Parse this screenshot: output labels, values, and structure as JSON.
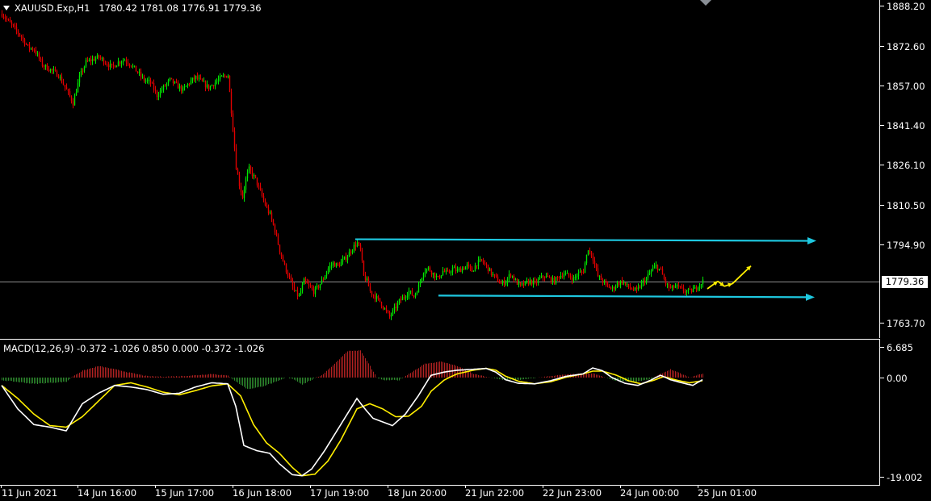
{
  "header": {
    "symbol": "XAUUSD.Exp,H1",
    "ohlc": "1780.42 1781.08 1776.91 1779.36"
  },
  "macd": {
    "label": "MACD(12,26,9) -0.372 -1.026 0.850 0.000 -0.372 -1.026",
    "scale": [
      "6.685",
      "0.00",
      "-19.002"
    ]
  },
  "price_axis": [
    "1888.20",
    "1872.60",
    "1857.00",
    "1841.40",
    "1826.10",
    "1810.50",
    "1794.90",
    "1779.36",
    "1763.70"
  ],
  "current_price": "1779.36",
  "time_axis": [
    "11 Jun 2021",
    "14 Jun 16:00",
    "15 Jun 17:00",
    "16 Jun 18:00",
    "17 Jun 19:00",
    "18 Jun 20:00",
    "21 Jun 22:00",
    "22 Jun 23:00",
    "24 Jun 00:00",
    "25 Jun 01:00"
  ],
  "colors": {
    "background": "#000000",
    "bull": "#00e600",
    "bear": "#e00000",
    "channel": "#1ec8e0",
    "projection": "#ffee00",
    "macd_line": "#ffffff",
    "signal_line": "#ffee00",
    "hist_pos": "#b22222",
    "hist_neg": "#2e8b2e"
  },
  "chart_data": {
    "type": "candlestick",
    "symbol": "XAUUSD.Exp",
    "timeframe": "H1",
    "price_ylim": [
      1760.0,
      1890.5
    ],
    "close_path": [
      [
        0,
        1885
      ],
      [
        4,
        1882
      ],
      [
        8,
        1879
      ],
      [
        12,
        1876
      ],
      [
        16,
        1872
      ],
      [
        20,
        1871
      ],
      [
        25,
        1865
      ],
      [
        30,
        1863
      ],
      [
        35,
        1861
      ],
      [
        40,
        1855
      ],
      [
        44,
        1850
      ],
      [
        48,
        1860
      ],
      [
        52,
        1866
      ],
      [
        56,
        1867
      ],
      [
        60,
        1868
      ],
      [
        64,
        1866
      ],
      [
        68,
        1864
      ],
      [
        72,
        1866
      ],
      [
        76,
        1867
      ],
      [
        80,
        1865
      ],
      [
        84,
        1862
      ],
      [
        88,
        1859
      ],
      [
        92,
        1858
      ],
      [
        96,
        1853
      ],
      [
        100,
        1856
      ],
      [
        104,
        1859
      ],
      [
        108,
        1857
      ],
      [
        112,
        1855
      ],
      [
        116,
        1858
      ],
      [
        120,
        1860
      ],
      [
        124,
        1858
      ],
      [
        128,
        1856
      ],
      [
        132,
        1858
      ],
      [
        136,
        1860
      ],
      [
        140,
        1861
      ],
      [
        143,
        1840
      ],
      [
        145,
        1825
      ],
      [
        147,
        1818
      ],
      [
        149,
        1813
      ],
      [
        151,
        1820
      ],
      [
        153,
        1824
      ],
      [
        155,
        1822
      ],
      [
        157,
        1820
      ],
      [
        160,
        1815
      ],
      [
        163,
        1810
      ],
      [
        166,
        1806
      ],
      [
        169,
        1800
      ],
      [
        172,
        1792
      ],
      [
        175,
        1786
      ],
      [
        178,
        1781
      ],
      [
        181,
        1776
      ],
      [
        184,
        1774
      ],
      [
        187,
        1780
      ],
      [
        190,
        1778
      ],
      [
        193,
        1776
      ],
      [
        196,
        1778
      ],
      [
        199,
        1781
      ],
      [
        202,
        1785
      ],
      [
        205,
        1787
      ],
      [
        208,
        1786
      ],
      [
        211,
        1788
      ],
      [
        214,
        1790
      ],
      [
        217,
        1793
      ],
      [
        220,
        1795
      ],
      [
        222,
        1792
      ],
      [
        224,
        1782
      ],
      [
        226,
        1780
      ],
      [
        228,
        1776
      ],
      [
        231,
        1774
      ],
      [
        234,
        1772
      ],
      [
        237,
        1769
      ],
      [
        240,
        1766
      ],
      [
        243,
        1769
      ],
      [
        246,
        1772
      ],
      [
        249,
        1774
      ],
      [
        252,
        1776
      ],
      [
        255,
        1774
      ],
      [
        258,
        1778
      ],
      [
        261,
        1784
      ],
      [
        264,
        1785
      ],
      [
        267,
        1783
      ],
      [
        270,
        1781
      ],
      [
        273,
        1784
      ],
      [
        276,
        1783
      ],
      [
        279,
        1785
      ],
      [
        282,
        1784
      ],
      [
        285,
        1785
      ],
      [
        288,
        1786
      ],
      [
        291,
        1784
      ],
      [
        294,
        1787
      ],
      [
        297,
        1788
      ],
      [
        300,
        1786
      ],
      [
        303,
        1783
      ],
      [
        306,
        1781
      ],
      [
        309,
        1779
      ],
      [
        312,
        1780
      ],
      [
        315,
        1783
      ],
      [
        318,
        1780
      ],
      [
        321,
        1778
      ],
      [
        324,
        1779
      ],
      [
        327,
        1780
      ],
      [
        330,
        1779
      ],
      [
        333,
        1781
      ],
      [
        336,
        1782
      ],
      [
        339,
        1781
      ],
      [
        342,
        1780
      ],
      [
        345,
        1782
      ],
      [
        348,
        1783
      ],
      [
        351,
        1782
      ],
      [
        354,
        1781
      ],
      [
        357,
        1783
      ],
      [
        360,
        1784
      ],
      [
        363,
        1793
      ],
      [
        366,
        1789
      ],
      [
        369,
        1782
      ],
      [
        372,
        1780
      ],
      [
        375,
        1778
      ],
      [
        378,
        1777
      ],
      [
        381,
        1779
      ],
      [
        384,
        1780
      ],
      [
        387,
        1778
      ],
      [
        390,
        1777
      ],
      [
        393,
        1776
      ],
      [
        396,
        1779
      ],
      [
        399,
        1781
      ],
      [
        402,
        1784
      ],
      [
        405,
        1786
      ],
      [
        408,
        1784
      ],
      [
        411,
        1779
      ],
      [
        414,
        1777
      ],
      [
        417,
        1778
      ],
      [
        420,
        1777
      ],
      [
        423,
        1776
      ],
      [
        426,
        1776
      ],
      [
        429,
        1777
      ],
      [
        432,
        1779
      ],
      [
        434,
        1780
      ]
    ],
    "channel": {
      "upper": 1796.0,
      "lower": 1774.2
    },
    "projection_path": [
      1777,
      1780,
      1778,
      1779,
      1786
    ],
    "macd": {
      "ylim": [
        -20.5,
        8.0
      ],
      "macd_path": [
        [
          0,
          -1.5
        ],
        [
          10,
          -6
        ],
        [
          20,
          -9
        ],
        [
          30,
          -9.5
        ],
        [
          40,
          -10.2
        ],
        [
          50,
          -5
        ],
        [
          60,
          -3
        ],
        [
          70,
          -1.5
        ],
        [
          80,
          -1.8
        ],
        [
          90,
          -2.3
        ],
        [
          100,
          -3.2
        ],
        [
          110,
          -3.0
        ],
        [
          120,
          -1.8
        ],
        [
          130,
          -1
        ],
        [
          140,
          -1.2
        ],
        [
          145,
          -5.5
        ],
        [
          150,
          -13
        ],
        [
          158,
          -14
        ],
        [
          166,
          -14.5
        ],
        [
          172,
          -16.5
        ],
        [
          180,
          -18.6
        ],
        [
          186,
          -18.8
        ],
        [
          192,
          -17.5
        ],
        [
          200,
          -14
        ],
        [
          210,
          -9
        ],
        [
          220,
          -4
        ],
        [
          225,
          -6
        ],
        [
          230,
          -7.8
        ],
        [
          236,
          -8.5
        ],
        [
          242,
          -9.2
        ],
        [
          250,
          -7
        ],
        [
          258,
          -3.5
        ],
        [
          266,
          0.5
        ],
        [
          274,
          1.2
        ],
        [
          282,
          1.6
        ],
        [
          292,
          1.8
        ],
        [
          300,
          2.0
        ],
        [
          306,
          1.2
        ],
        [
          312,
          -0.4
        ],
        [
          320,
          -1.1
        ],
        [
          330,
          -1.2
        ],
        [
          340,
          -0.6
        ],
        [
          350,
          0.3
        ],
        [
          360,
          0.8
        ],
        [
          366,
          2.1
        ],
        [
          372,
          1.5
        ],
        [
          378,
          0
        ],
        [
          386,
          -1.1
        ],
        [
          394,
          -1.5
        ],
        [
          402,
          -0.5
        ],
        [
          408,
          0.5
        ],
        [
          414,
          -0.4
        ],
        [
          420,
          -0.9
        ],
        [
          428,
          -1.5
        ],
        [
          434,
          -0.4
        ]
      ],
      "signal_path": [
        [
          0,
          -1.5
        ],
        [
          10,
          -4
        ],
        [
          20,
          -7
        ],
        [
          30,
          -9.2
        ],
        [
          40,
          -9.5
        ],
        [
          50,
          -7.5
        ],
        [
          60,
          -4.5
        ],
        [
          70,
          -1.5
        ],
        [
          80,
          -1.0
        ],
        [
          90,
          -1.8
        ],
        [
          100,
          -2.8
        ],
        [
          110,
          -3.3
        ],
        [
          120,
          -2.5
        ],
        [
          130,
          -1.6
        ],
        [
          140,
          -1.2
        ],
        [
          148,
          -3.5
        ],
        [
          156,
          -9
        ],
        [
          164,
          -12.5
        ],
        [
          172,
          -14.5
        ],
        [
          180,
          -17.2
        ],
        [
          186,
          -18.8
        ],
        [
          194,
          -18.5
        ],
        [
          202,
          -16
        ],
        [
          210,
          -12
        ],
        [
          220,
          -6
        ],
        [
          228,
          -5
        ],
        [
          236,
          -6
        ],
        [
          244,
          -7.5
        ],
        [
          252,
          -7.4
        ],
        [
          260,
          -5.5
        ],
        [
          266,
          -2.6
        ],
        [
          274,
          -0.5
        ],
        [
          282,
          0.8
        ],
        [
          292,
          1.6
        ],
        [
          300,
          2.0
        ],
        [
          306,
          1.6
        ],
        [
          312,
          0.3
        ],
        [
          320,
          -0.7
        ],
        [
          330,
          -1.2
        ],
        [
          340,
          -0.8
        ],
        [
          350,
          0.1
        ],
        [
          360,
          0.8
        ],
        [
          366,
          1.4
        ],
        [
          372,
          1.4
        ],
        [
          380,
          0.6
        ],
        [
          388,
          -0.6
        ],
        [
          396,
          -1.2
        ],
        [
          404,
          -0.5
        ],
        [
          410,
          0.2
        ],
        [
          418,
          -0.5
        ],
        [
          426,
          -1.0
        ],
        [
          434,
          -0.6
        ]
      ],
      "histogram_path": [
        [
          0,
          -0.5
        ],
        [
          20,
          -1.2
        ],
        [
          40,
          -0.8
        ],
        [
          44,
          0.3
        ],
        [
          50,
          1.5
        ],
        [
          60,
          2.5
        ],
        [
          70,
          1.8
        ],
        [
          80,
          1.0
        ],
        [
          90,
          0.3
        ],
        [
          100,
          0.2
        ],
        [
          110,
          0.3
        ],
        [
          120,
          0.5
        ],
        [
          130,
          0.8
        ],
        [
          140,
          0.4
        ],
        [
          146,
          -1.0
        ],
        [
          152,
          -2.2
        ],
        [
          160,
          -1.8
        ],
        [
          170,
          -0.8
        ],
        [
          176,
          0.0
        ],
        [
          180,
          -0.2
        ],
        [
          186,
          -1.3
        ],
        [
          192,
          -0.4
        ],
        [
          198,
          0.5
        ],
        [
          206,
          3.0
        ],
        [
          214,
          5.8
        ],
        [
          222,
          5.9
        ],
        [
          228,
          2.5
        ],
        [
          232,
          0.0
        ],
        [
          236,
          -0.5
        ],
        [
          246,
          -0.5
        ],
        [
          252,
          0.8
        ],
        [
          262,
          3.0
        ],
        [
          272,
          3.5
        ],
        [
          282,
          2.5
        ],
        [
          292,
          0.8
        ],
        [
          302,
          0.0
        ],
        [
          310,
          -0.4
        ],
        [
          322,
          -0.4
        ],
        [
          332,
          0.0
        ],
        [
          344,
          0.5
        ],
        [
          356,
          0.8
        ],
        [
          366,
          0.9
        ],
        [
          372,
          0.2
        ],
        [
          380,
          -0.6
        ],
        [
          392,
          -0.8
        ],
        [
          402,
          -0.3
        ],
        [
          408,
          0.8
        ],
        [
          414,
          1.8
        ],
        [
          420,
          0.9
        ],
        [
          426,
          0.0
        ],
        [
          434,
          0.9
        ]
      ]
    }
  }
}
